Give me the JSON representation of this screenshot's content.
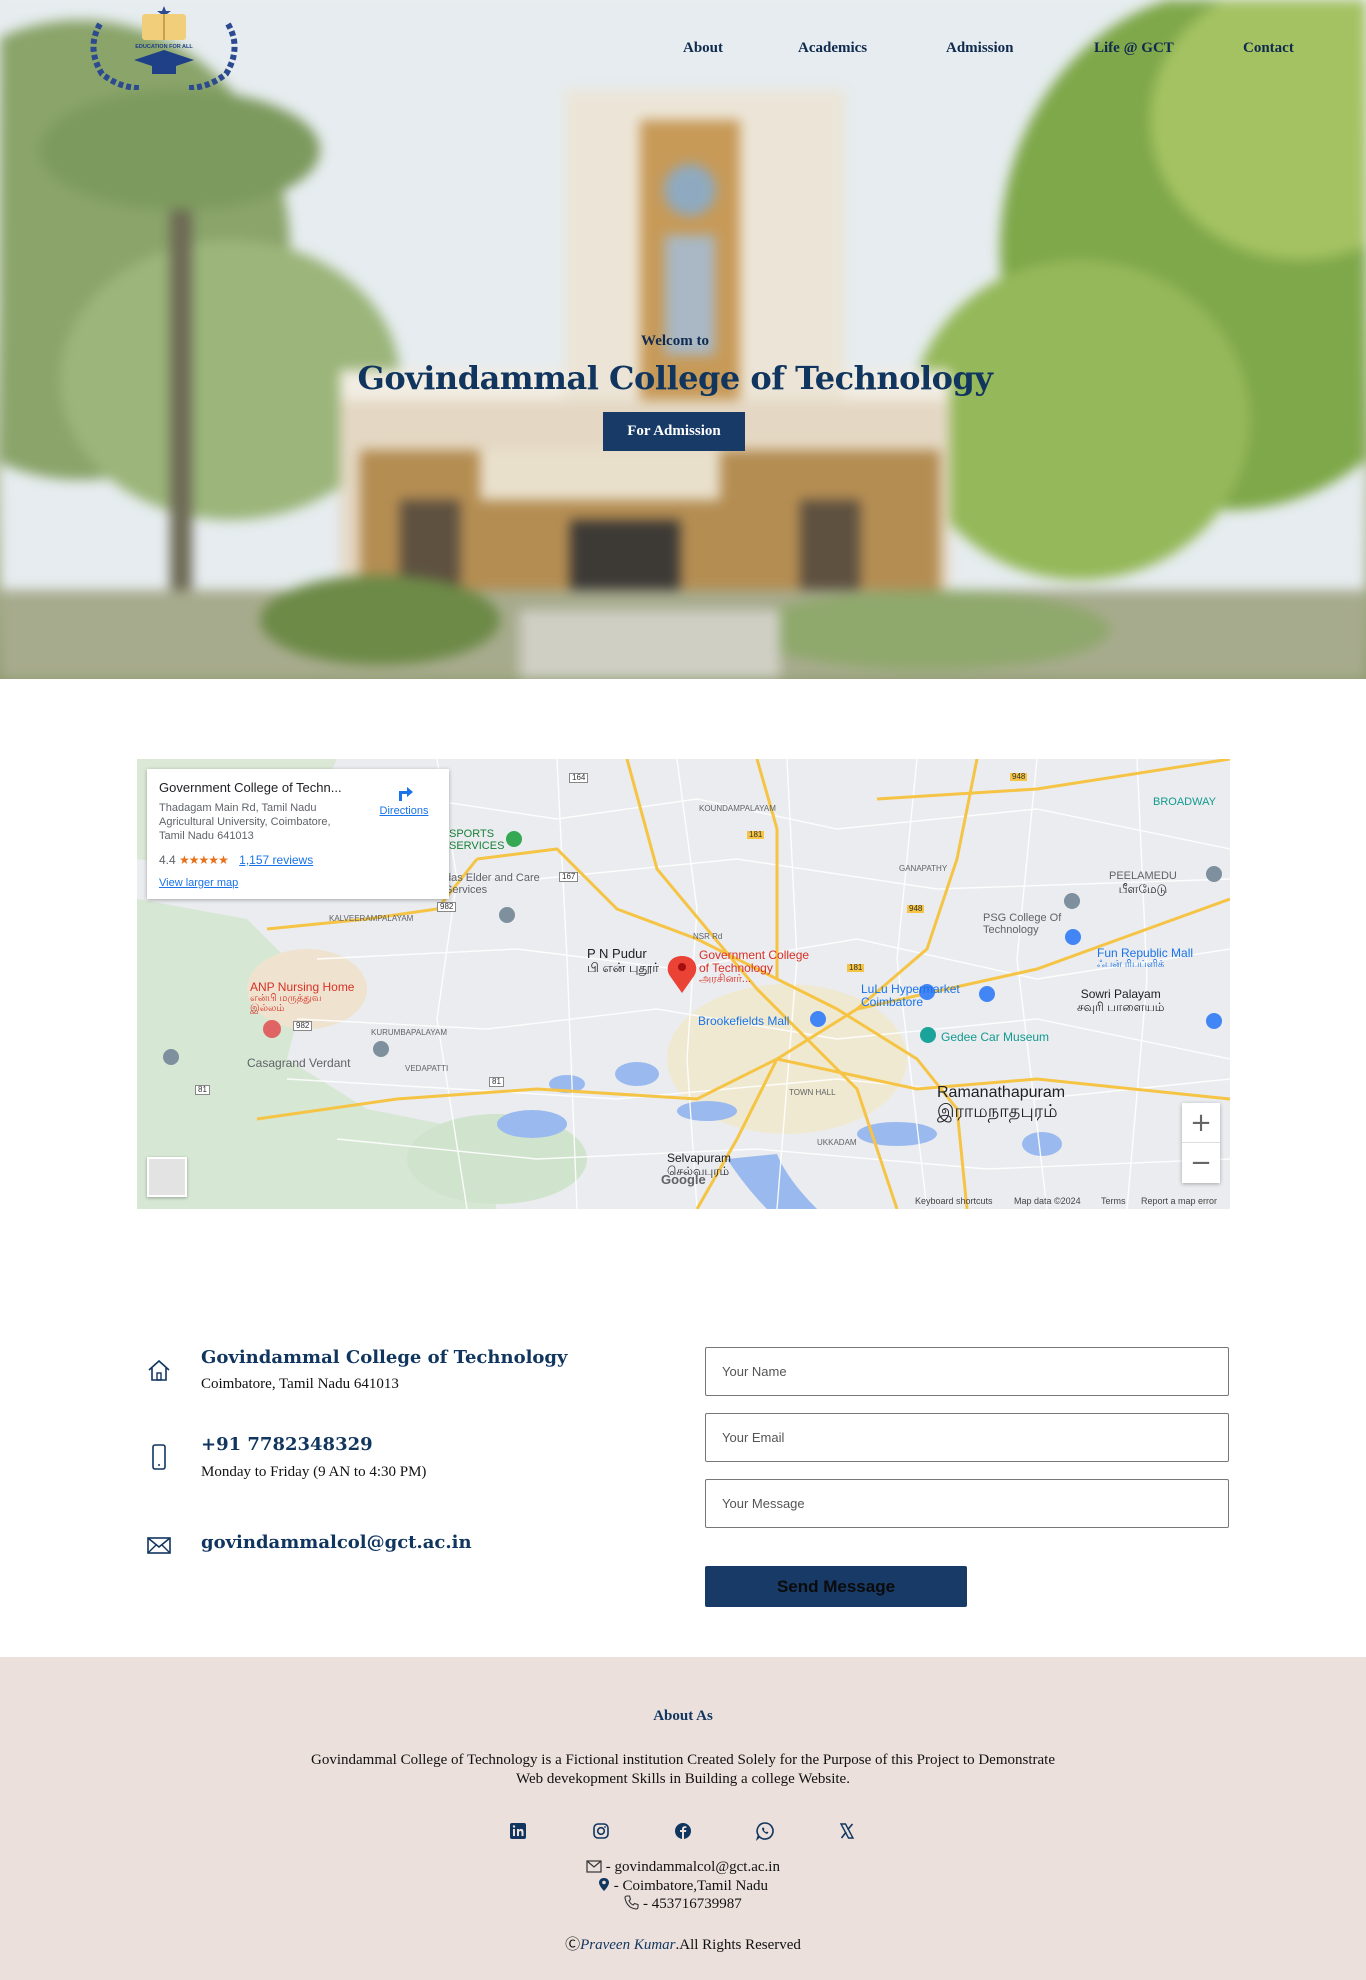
{
  "nav": {
    "logo_text": "EDUCATION FOR ALL",
    "items": [
      "About",
      "Academics",
      "Admission",
      "Life @ GCT",
      "Contact"
    ]
  },
  "hero": {
    "subtitle": "Welcom to",
    "title": "Govindammal College of Technology",
    "button": "For Admission"
  },
  "map": {
    "card": {
      "title": "Government College of Techn...",
      "address": "Thadagam Main Rd, Tamil Nadu Agricultural University, Coimbatore, Tamil Nadu 641013",
      "rating": "4.4",
      "stars": "★★★★★",
      "reviews": "1,157 reviews",
      "directions": "Directions",
      "larger_map": "View larger map"
    },
    "labels": {
      "pin_en": "Government College of Technology",
      "pin_ta": "அரசினர்...",
      "ramanathapuram_en": "Ramanathapuram",
      "ramanathapuram_ta": "இராமநாதபுரம்",
      "ppudur_en": "P N Pudur",
      "ppudur_ta": "பி என் புதூர்",
      "brookefields": "Brookefields Mall",
      "lulu": "LuLu Hypermarket Coimbatore",
      "gedee": "Gedee Car Museum",
      "funrepublic": "Fun Republic Mall",
      "funrepublic_ta": "ஃபன் ரிபப்ளிக்",
      "anp": "ANP Nursing Home",
      "anp_ta": "என்பி மருத்துவ இல்லம்",
      "casagrand": "Casagrand Verdant",
      "selvapuram": "Selvapuram",
      "selvapuram_ta": "செல்வபுரம்",
      "sowri": "Sowri Palayam",
      "sowri_ta": "சவுரி பாளையம்",
      "peelamedu": "PEELAMEDU",
      "peelamedu_ta": "பீளமேடு",
      "psg": "PSG College Of Technology",
      "koundampalayam": "KOUNDAMPALAYAM",
      "ganapathy": "GANAPATHY",
      "kalveerampalayam": "KALVEERAMPALAYAM",
      "kurumbapalayam": "KURUMBAPALAYAM",
      "vedapatti": "VEDAPATTI",
      "townhall": "TOWN HALL",
      "ukkadam": "UKKADAM",
      "broadway": "BROADWAY",
      "sports": "SPORTS SERVICES",
      "elder": "das Elder and Care Services",
      "nsr": "NSR Rd",
      "route_948": "948",
      "route_181": "181",
      "route_167": "167",
      "route_164": "164",
      "route_982": "982",
      "route_81": "81",
      "google": "Google"
    },
    "footer": {
      "shortcuts": "Keyboard shortcuts",
      "data": "Map data ©2024",
      "terms": "Terms",
      "report": "Report a map error"
    },
    "zoom_in": "+",
    "zoom_out": "−"
  },
  "contact": {
    "address_title": "Govindammal College of Technology",
    "address_sub": "Coimbatore, Tamil Nadu 641013",
    "phone_title": "+91 7782348329",
    "phone_sub": "Monday to Friday (9 AN to 4:30 PM)",
    "email_title": "govindammalcol@gct.ac.in"
  },
  "form": {
    "name_placeholder": "Your Name",
    "email_placeholder": "Your Email",
    "message_placeholder": "Your Message",
    "send": "Send Message"
  },
  "footer": {
    "heading": "About As",
    "text": "Govindammal College of Technology is a Fictional institution Created Solely for the Purpose of this Project to Demonstrate Web devekopment Skills in Building a college Website.",
    "email_line": " - govindammalcol@gct.ac.in",
    "location_line": " - Coimbatore,Tamil Nadu",
    "phone_line": " - 453716739987",
    "copyright_symbol": "Ⓒ",
    "author": "Praveen Kumar",
    "rights": ".All Rights Reserved"
  },
  "colors": {
    "primary": "#10355f",
    "button": "#173a67",
    "footer_bg": "#ebe0dc"
  }
}
